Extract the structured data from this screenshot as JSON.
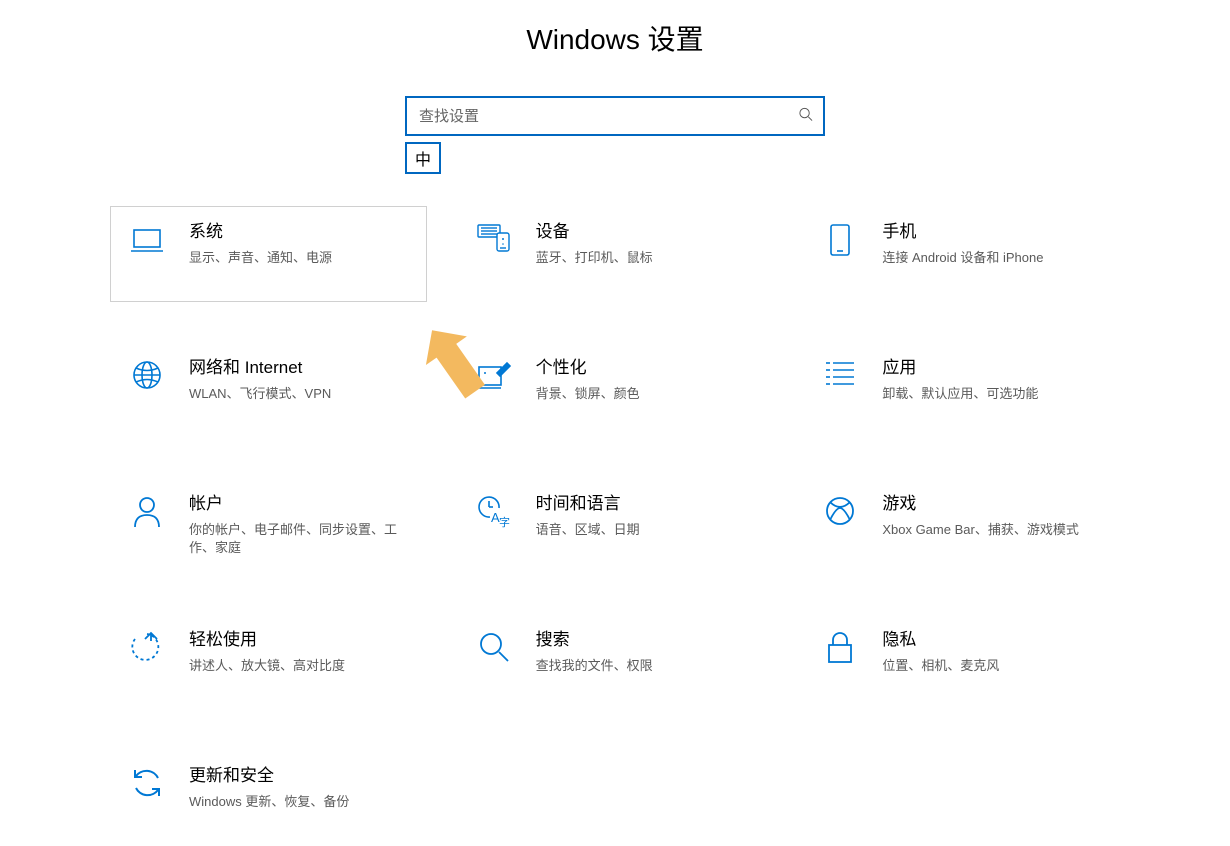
{
  "page_title": "Windows 设置",
  "search": {
    "placeholder": "查找设置"
  },
  "ime_badge": "中",
  "selected_index": 0,
  "tiles": [
    {
      "id": "system",
      "title": "系统",
      "desc": "显示、声音、通知、电源"
    },
    {
      "id": "devices",
      "title": "设备",
      "desc": "蓝牙、打印机、鼠标"
    },
    {
      "id": "phone",
      "title": "手机",
      "desc": "连接 Android 设备和 iPhone"
    },
    {
      "id": "network",
      "title": "网络和 Internet",
      "desc": "WLAN、飞行模式、VPN"
    },
    {
      "id": "personalization",
      "title": "个性化",
      "desc": "背景、锁屏、颜色"
    },
    {
      "id": "apps",
      "title": "应用",
      "desc": "卸载、默认应用、可选功能"
    },
    {
      "id": "accounts",
      "title": "帐户",
      "desc": "你的帐户、电子邮件、同步设置、工作、家庭"
    },
    {
      "id": "time-language",
      "title": "时间和语言",
      "desc": "语音、区域、日期"
    },
    {
      "id": "gaming",
      "title": "游戏",
      "desc": "Xbox Game Bar、捕获、游戏模式"
    },
    {
      "id": "ease-of-access",
      "title": "轻松使用",
      "desc": "讲述人、放大镜、高对比度"
    },
    {
      "id": "search",
      "title": "搜索",
      "desc": "查找我的文件、权限"
    },
    {
      "id": "privacy",
      "title": "隐私",
      "desc": "位置、相机、麦克风"
    },
    {
      "id": "update-security",
      "title": "更新和安全",
      "desc": "Windows 更新、恢复、备份"
    }
  ]
}
